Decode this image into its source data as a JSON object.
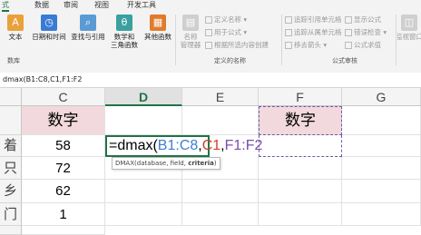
{
  "ribbon": {
    "tabs": [
      "式",
      "数据",
      "审阅",
      "视图",
      "开发工具"
    ],
    "active_tab": "式",
    "buttons": [
      {
        "label1": "文本",
        "label2": ""
      },
      {
        "label1": "日期和时间",
        "label2": ""
      },
      {
        "label1": "查找与引用",
        "label2": ""
      },
      {
        "label1": "数学和",
        "label2": "三角函数"
      },
      {
        "label1": "其他函数",
        "label2": ""
      }
    ],
    "name_manager": {
      "label1": "名称",
      "label2": "管理器"
    },
    "defined_names": {
      "define_name": "定义名称",
      "use_in_formula": "用于公式",
      "create_from_selection": "根据所选内容创建",
      "group_label": "定义的名称"
    },
    "formula_auditing": {
      "trace_precedents": "追踪引用单元格",
      "trace_dependents": "追踪从属单元格",
      "remove_arrows": "移去箭头",
      "show_formulas": "显示公式",
      "error_checking": "错误检查",
      "evaluate_formula": "公式求值",
      "group_label": "公式审核"
    },
    "watch_window": "监视窗口",
    "library_group_label": "数库"
  },
  "formula_bar": {
    "content": "dmax(B1:C8,C1,F1:F2"
  },
  "columns": [
    "C",
    "D",
    "E",
    "F",
    "G"
  ],
  "selected_column": "D",
  "row_headers": [
    "",
    "着",
    "只",
    "乡",
    "门",
    ""
  ],
  "cells": {
    "c1": "数字",
    "c2": "58",
    "c3": "72",
    "c4": "62",
    "c5": "1",
    "f1": "数字"
  },
  "formula_edit": {
    "prefix": "=dmax(",
    "arg1": "B1:C8",
    "comma1": ",",
    "arg2": "C1",
    "comma2": ",",
    "arg3": "F1:F2"
  },
  "tooltip": {
    "text": "DMAX(database, field, ",
    "bold_arg": "criteria",
    "suffix": ")"
  },
  "colors": {
    "arg1": "#3d7fd1",
    "arg2": "#d83a2b",
    "arg3": "#7a4fb0",
    "accent": "#217346",
    "header_fill": "#f2d9dd"
  }
}
